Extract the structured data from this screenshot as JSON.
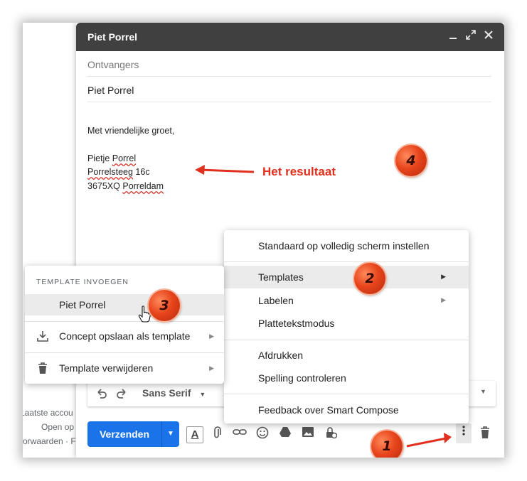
{
  "background": {
    "lines": [
      "Laatste accou",
      "Open op",
      "orwaarden · F"
    ]
  },
  "compose": {
    "title": "Piet Porrel",
    "title_controls": [
      "minimize-icon",
      "fullscreen-icon",
      "close-icon"
    ],
    "recipients_placeholder": "Ontvangers",
    "subject": "Piet Porrel",
    "body": {
      "greeting": "Met vriendelijke groet,",
      "name_first": "Pietje",
      "name_last": "Porrel",
      "street_name": "Porrelsteeg",
      "street_number": "16c",
      "postcode": "3675XQ",
      "city": "Porreldam"
    },
    "format_bar": {
      "font": "Sans Serif"
    },
    "send_label": "Verzenden",
    "send_button_color": "#1a73e8",
    "bottom_tools": [
      "text-format-icon",
      "attach-icon",
      "link-icon",
      "emoji-icon",
      "drive-icon",
      "photo-icon",
      "confidential-icon"
    ]
  },
  "annotations": {
    "result_label": "Het resultaat",
    "badges": [
      "1",
      "2",
      "3",
      "4"
    ],
    "color": "#e0301e"
  },
  "more_options_menu": {
    "items": [
      {
        "label": "Standaard op volledig scherm instellen"
      },
      {
        "label": "Templates",
        "submenu": true,
        "highlighted": true
      },
      {
        "label": "Labelen",
        "submenu": true
      },
      {
        "label": "Plattetekstmodus"
      },
      {
        "label": "Afdrukken"
      },
      {
        "label": "Spelling controleren"
      },
      {
        "label": "Feedback over Smart Compose"
      }
    ]
  },
  "templates_menu": {
    "header": "TEMPLATE INVOEGEN",
    "template_item": "Piet Porrel",
    "save_label": "Concept opslaan als template",
    "delete_label": "Template verwijderen"
  }
}
